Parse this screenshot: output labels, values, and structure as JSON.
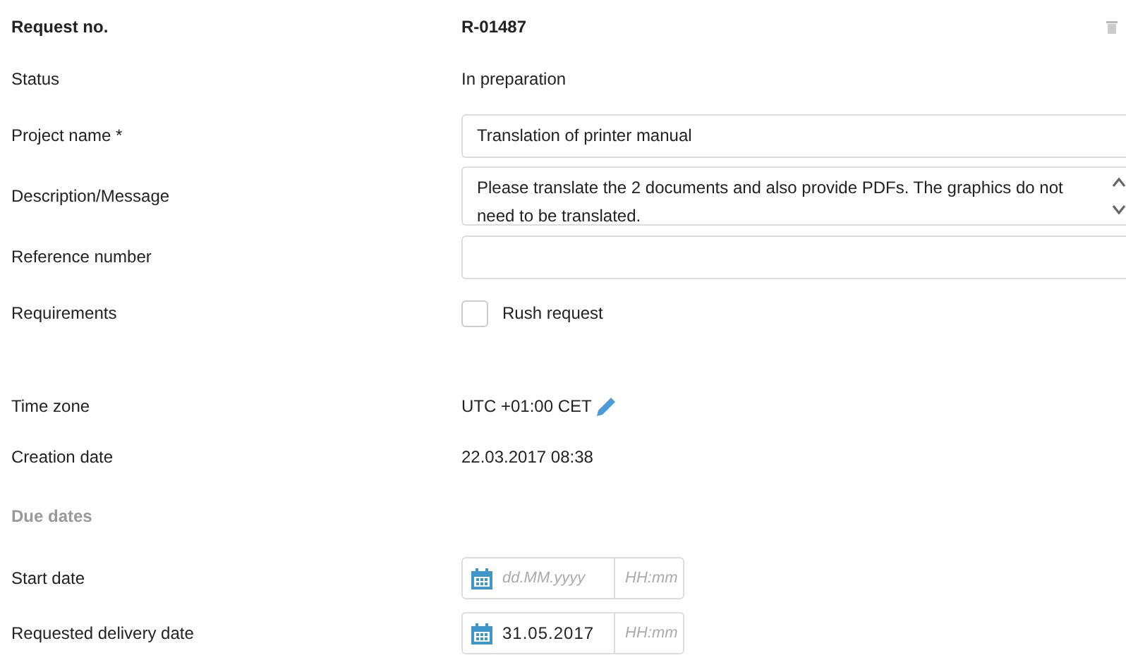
{
  "fields": [
    {
      "kind": "value",
      "label": "Request no.",
      "value": "R-01487"
    },
    {
      "kind": "text",
      "label": "Status",
      "value": "In preparation"
    },
    {
      "kind": "input",
      "label": "Project name *",
      "value": "Translation of printer manual"
    },
    {
      "kind": "textarea",
      "label": "Description/Message",
      "value": "Please translate the 2 documents and also provide PDFs. The graphics do not need to be translated."
    },
    {
      "kind": "input",
      "label": "Reference number"
    },
    {
      "kind": "checkbox",
      "label": "Requirements",
      "option": "Rush request",
      "checked": false
    },
    {
      "kind": "timezone",
      "label": "Time zone",
      "value": "UTC +01:00 CET"
    },
    {
      "kind": "text",
      "label": "Creation date",
      "value": "22.03.2017 08:38"
    },
    {
      "kind": "section",
      "label": "Due dates"
    },
    {
      "kind": "date",
      "label": "Start date",
      "date_placeholder": "dd.MM.yyyy",
      "time_placeholder": "HH:mm"
    },
    {
      "kind": "date",
      "label": "Requested delivery date",
      "value": "31.05.2017",
      "time_placeholder": "HH:mm"
    }
  ]
}
